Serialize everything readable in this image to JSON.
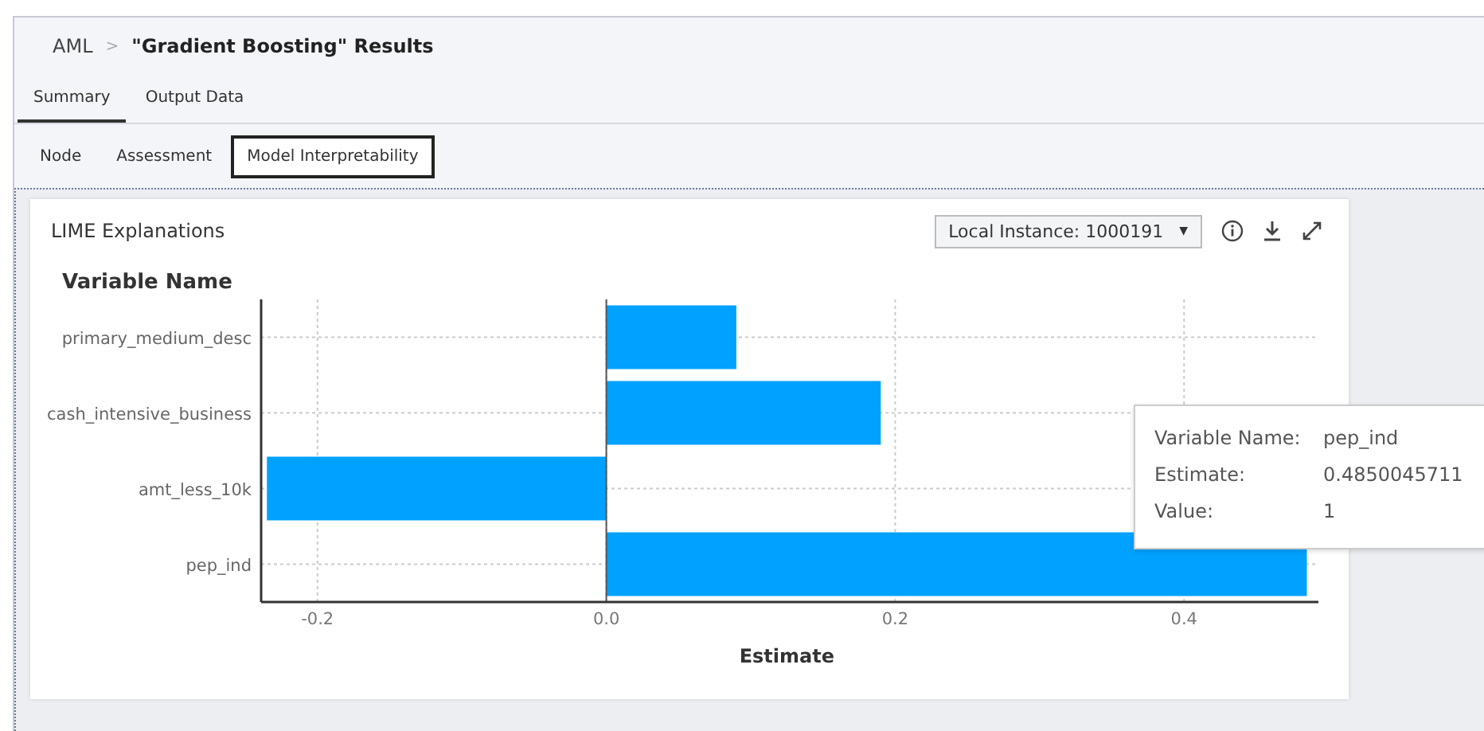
{
  "breadcrumb": {
    "parent": "AML",
    "separator": ">",
    "title": "\"Gradient Boosting\" Results"
  },
  "tabs": [
    {
      "label": "Summary",
      "selected": true
    },
    {
      "label": "Output Data",
      "selected": false
    }
  ],
  "subtabs": [
    {
      "label": "Node",
      "selected": false
    },
    {
      "label": "Assessment",
      "selected": false
    },
    {
      "label": "Model Interpretability",
      "selected": true
    }
  ],
  "card": {
    "title": "LIME Explanations",
    "instance_dropdown": "Local Instance: 1000191",
    "dropdown_caret": "▼",
    "chart_data": {
      "type": "bar",
      "orientation": "horizontal",
      "ylabel": "Variable Name",
      "xlabel": "Estimate",
      "categories": [
        "primary_medium_desc",
        "cash_intensive_business",
        "amt_less_10k",
        "pep_ind"
      ],
      "values": [
        0.09,
        0.19,
        -0.235,
        0.485
      ],
      "grid": true,
      "xlim": [
        -0.239,
        0.493
      ],
      "xticks": [
        {
          "value": -0.2,
          "label": "-0.2"
        },
        {
          "value": 0,
          "label": "0.0"
        },
        {
          "value": 0.2,
          "label": "0.2"
        },
        {
          "value": 0.4,
          "label": "0.4"
        }
      ]
    },
    "tooltip": [
      {
        "label": "Variable Name:",
        "value": "pep_ind"
      },
      {
        "label": "Estimate:",
        "value": "0.4850045711"
      },
      {
        "label": "Value:",
        "value": "1"
      }
    ]
  }
}
